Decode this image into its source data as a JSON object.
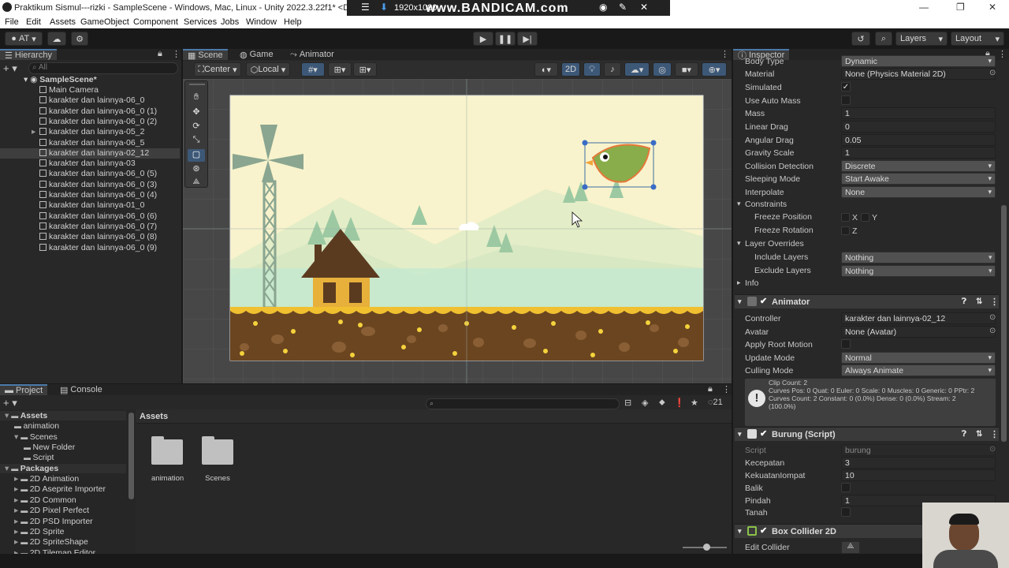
{
  "window": {
    "title": "Praktikum Sismul---rizki - SampleScene - Windows, Mac, Linux - Unity 2022.3.22f1* <DX11>",
    "controls": [
      "—",
      "❐",
      "✕"
    ]
  },
  "recorder": {
    "resolution": "1920x1080",
    "logo": "www.BANDICAM.com"
  },
  "menu": [
    "File",
    "Edit",
    "Assets",
    "GameObject",
    "Component",
    "Services",
    "Jobs",
    "Window",
    "Help"
  ],
  "toolbar": {
    "account": "AT",
    "layers": "Layers",
    "layout": "Layout"
  },
  "hierarchy": {
    "tab": "Hierarchy",
    "search_placeholder": "All",
    "scene": "SampleScene*",
    "items": [
      {
        "label": "Main Camera",
        "selected": false,
        "expandable": false
      },
      {
        "label": "karakter dan lainnya-06_0",
        "selected": false,
        "expandable": false
      },
      {
        "label": "karakter dan lainnya-06_0 (1)",
        "selected": false,
        "expandable": false
      },
      {
        "label": "karakter dan lainnya-06_0 (2)",
        "selected": false,
        "expandable": false
      },
      {
        "label": "karakter dan lainnya-05_2",
        "selected": false,
        "expandable": true
      },
      {
        "label": "karakter dan lainnya-06_5",
        "selected": false,
        "expandable": false
      },
      {
        "label": "karakter dan lainnya-02_12",
        "selected": true,
        "expandable": false
      },
      {
        "label": "karakter dan lainnya-03",
        "selected": false,
        "expandable": false
      },
      {
        "label": "karakter dan lainnya-06_0 (5)",
        "selected": false,
        "expandable": false
      },
      {
        "label": "karakter dan lainnya-06_0 (3)",
        "selected": false,
        "expandable": false
      },
      {
        "label": "karakter dan lainnya-06_0 (4)",
        "selected": false,
        "expandable": false
      },
      {
        "label": "karakter dan lainnya-01_0",
        "selected": false,
        "expandable": false
      },
      {
        "label": "karakter dan lainnya-06_0 (6)",
        "selected": false,
        "expandable": false
      },
      {
        "label": "karakter dan lainnya-06_0 (7)",
        "selected": false,
        "expandable": false
      },
      {
        "label": "karakter dan lainnya-06_0 (8)",
        "selected": false,
        "expandable": false
      },
      {
        "label": "karakter dan lainnya-06_0 (9)",
        "selected": false,
        "expandable": false
      }
    ]
  },
  "scene_view": {
    "tabs": [
      "Scene",
      "Game",
      "Animator"
    ],
    "pivot": "Center",
    "space": "Local",
    "mode_2d": "2D"
  },
  "project": {
    "tabs": [
      "Project",
      "Console"
    ],
    "breadcrumb": "Assets",
    "hidden_count": "21",
    "tree": [
      {
        "label": "Assets",
        "bold": true,
        "depth": 0
      },
      {
        "label": "animation",
        "bold": false,
        "depth": 1
      },
      {
        "label": "Scenes",
        "bold": false,
        "depth": 1
      },
      {
        "label": "New Folder",
        "bold": false,
        "depth": 2
      },
      {
        "label": "Script",
        "bold": false,
        "depth": 2
      },
      {
        "label": "Packages",
        "bold": true,
        "depth": 0
      },
      {
        "label": "2D Animation",
        "bold": false,
        "depth": 1
      },
      {
        "label": "2D Aseprite Importer",
        "bold": false,
        "depth": 1
      },
      {
        "label": "2D Common",
        "bold": false,
        "depth": 1
      },
      {
        "label": "2D Pixel Perfect",
        "bold": false,
        "depth": 1
      },
      {
        "label": "2D PSD Importer",
        "bold": false,
        "depth": 1
      },
      {
        "label": "2D Sprite",
        "bold": false,
        "depth": 1
      },
      {
        "label": "2D SpriteShape",
        "bold": false,
        "depth": 1
      },
      {
        "label": "2D Tilemap Editor",
        "bold": false,
        "depth": 1
      }
    ],
    "folders": [
      "animation",
      "Scenes"
    ]
  },
  "inspector": {
    "tab": "Inspector",
    "rigidbody": [
      {
        "label": "Body Type",
        "value": "Dynamic",
        "kind": "dropdown"
      },
      {
        "label": "Material",
        "value": "None (Physics Material 2D)",
        "kind": "object"
      },
      {
        "label": "Simulated",
        "value": "✓",
        "kind": "check"
      },
      {
        "label": "Use Auto Mass",
        "value": "",
        "kind": "check"
      },
      {
        "label": "Mass",
        "value": "1",
        "kind": "field"
      },
      {
        "label": "Linear Drag",
        "value": "0",
        "kind": "field"
      },
      {
        "label": "Angular Drag",
        "value": "0.05",
        "kind": "field"
      },
      {
        "label": "Gravity Scale",
        "value": "1",
        "kind": "field"
      },
      {
        "label": "Collision Detection",
        "value": "Discrete",
        "kind": "dropdown"
      },
      {
        "label": "Sleeping Mode",
        "value": "Start Awake",
        "kind": "dropdown"
      },
      {
        "label": "Interpolate",
        "value": "None",
        "kind": "dropdown"
      }
    ],
    "constraints": {
      "title": "Constraints",
      "freeze_position": "Freeze Position",
      "freeze_rotation": "Freeze Rotation",
      "x": "X",
      "y": "Y",
      "z": "Z"
    },
    "layer_overrides": {
      "title": "Layer Overrides",
      "include_label": "Include Layers",
      "include_value": "Nothing",
      "exclude_label": "Exclude Layers",
      "exclude_value": "Nothing"
    },
    "info": "Info",
    "animator": {
      "title": "Animator",
      "rows": [
        {
          "label": "Controller",
          "value": "karakter dan lainnya-02_12",
          "kind": "object"
        },
        {
          "label": "Avatar",
          "value": "None (Avatar)",
          "kind": "object"
        },
        {
          "label": "Apply Root Motion",
          "value": "",
          "kind": "check"
        },
        {
          "label": "Update Mode",
          "value": "Normal",
          "kind": "dropdown"
        },
        {
          "label": "Culling Mode",
          "value": "Always Animate",
          "kind": "dropdown"
        }
      ],
      "info_lines": [
        "Clip Count: 2",
        "Curves Pos: 0 Quat: 0 Euler: 0 Scale: 0 Muscles: 0 Generic: 0 PPtr: 2",
        "Curves Count: 2 Constant: 0 (0.0%) Dense: 0 (0.0%) Stream: 2",
        "(100.0%)"
      ]
    },
    "burung": {
      "title": "Burung (Script)",
      "rows": [
        {
          "label": "Script",
          "value": "burung",
          "kind": "object"
        },
        {
          "label": "Kecepatan",
          "value": "3",
          "kind": "field"
        },
        {
          "label": "KekuatanIompat",
          "value": "10",
          "kind": "field"
        },
        {
          "label": "Balik",
          "value": "",
          "kind": "check"
        },
        {
          "label": "Pindah",
          "value": "1",
          "kind": "field"
        },
        {
          "label": "Tanah",
          "value": "",
          "kind": "check"
        }
      ]
    },
    "box_collider": {
      "title": "Box Collider 2D",
      "edit_label": "Edit Collider"
    }
  }
}
